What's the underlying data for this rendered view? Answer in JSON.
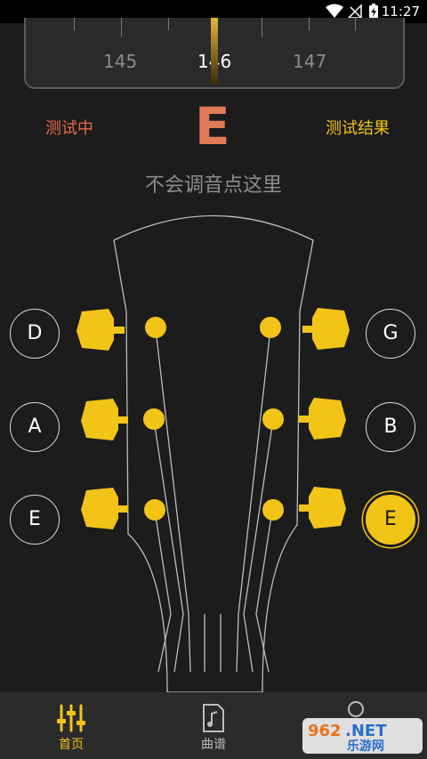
{
  "status_bar": {
    "time": "11:27"
  },
  "meter": {
    "left_value": "145",
    "center_value": "146",
    "right_value": "147"
  },
  "tuner": {
    "status_left": "测试中",
    "current_note": "E",
    "status_right": "测试结果",
    "help_link": "不会调音点这里"
  },
  "strings": {
    "left": [
      "D",
      "A",
      "E"
    ],
    "right": [
      "G",
      "B",
      "E"
    ],
    "selected": "E (bottom right)"
  },
  "tabs": [
    {
      "label": "首页",
      "icon": "tuner-sliders-icon",
      "active": true
    },
    {
      "label": "曲谱",
      "icon": "music-sheet-icon",
      "active": false
    }
  ],
  "watermark": {
    "text_top": "962.NET",
    "text_bottom": "乐游网"
  },
  "colors": {
    "accent": "#f2c417",
    "warning": "#e86a46",
    "background": "#1c1c1c",
    "tab_bar": "#2b2b2b"
  }
}
